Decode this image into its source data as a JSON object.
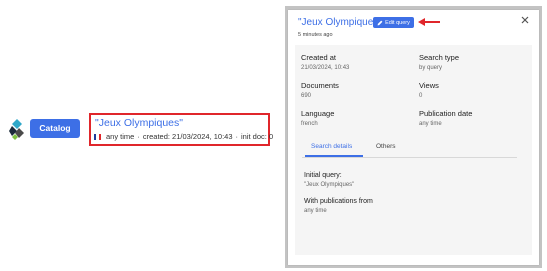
{
  "catalog_button": {
    "label": "Catalog"
  },
  "search_card": {
    "title": "\"Jeux Olympiques\"",
    "language_flag": [
      "#1f3b9c",
      "#ffffff",
      "#e0262b"
    ],
    "period": "any time",
    "created": "created: 21/03/2024, 10:43",
    "init_doc": "init doc: 0"
  },
  "modal": {
    "title": "\"Jeux Olympiques\"",
    "edit_button": "Edit query",
    "time_ago": "5 minutes ago",
    "fields": {
      "created_at": {
        "label": "Created at",
        "value": "21/03/2024, 10:43"
      },
      "search_type": {
        "label": "Search type",
        "value": "by query"
      },
      "documents": {
        "label": "Documents",
        "value": "690"
      },
      "views": {
        "label": "Views",
        "value": "0"
      },
      "language": {
        "label": "Language",
        "value": "french"
      },
      "publication_date": {
        "label": "Publication date",
        "value": "any time"
      }
    },
    "tabs": [
      "Search details",
      "Others"
    ],
    "active_tab": "Search details",
    "search_details": {
      "initial_query_label": "Initial query:",
      "initial_query_value": "\"Jeux Olympiques\"",
      "with_publications_label": "With publications from",
      "with_publications_value": "any time"
    }
  },
  "colors": {
    "accent": "#3d6fe6",
    "highlight": "#e0262b"
  },
  "icons": [
    "app-logo-icon",
    "pencil-icon",
    "close-icon",
    "red-arrow-icon"
  ]
}
